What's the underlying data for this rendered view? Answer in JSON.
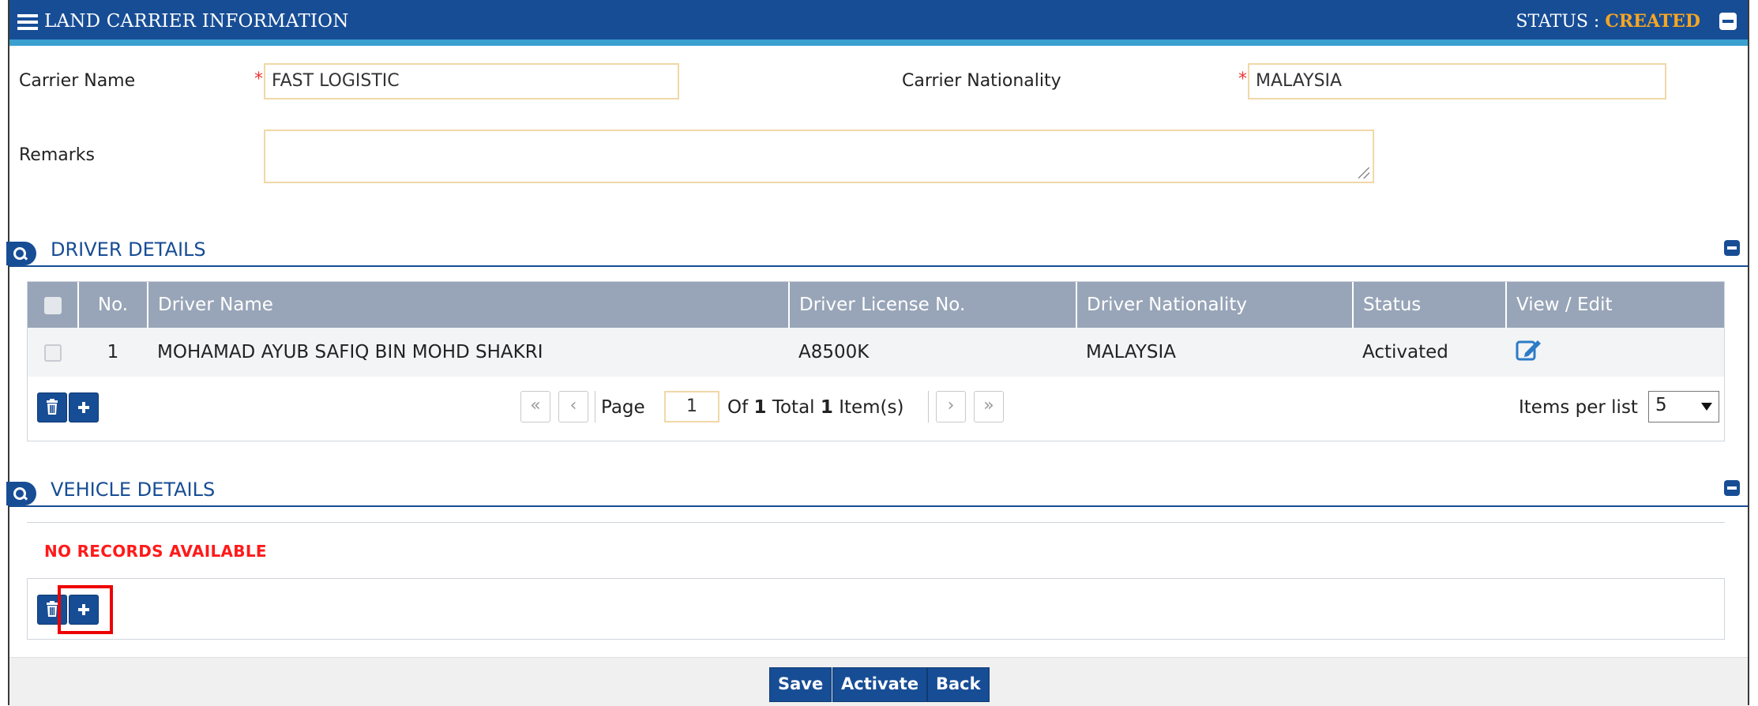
{
  "header": {
    "title": "LAND CARRIER INFORMATION",
    "status_label": "STATUS :",
    "status_value": "CREATED"
  },
  "form": {
    "carrier_name_label": "Carrier Name",
    "carrier_name_value": "FAST LOGISTIC",
    "carrier_nationality_label": "Carrier Nationality",
    "carrier_nationality_value": "MALAYSIA",
    "remarks_label": "Remarks",
    "remarks_value": "",
    "required_mark": "*"
  },
  "driver_section": {
    "title": "DRIVER DETAILS",
    "columns": [
      "No.",
      "Driver Name",
      "Driver License No.",
      "Driver Nationality",
      "Status",
      "View / Edit"
    ],
    "rows": [
      {
        "no": "1",
        "name": "MOHAMAD AYUB SAFIQ BIN MOHD SHAKRI",
        "license": "A8500K",
        "nationality": "MALAYSIA",
        "status": "Activated"
      }
    ],
    "pager": {
      "page_label": "Page",
      "page_value": "1",
      "of_label": "Of",
      "total_pages": "1",
      "total_label": "Total",
      "total_items": "1",
      "items_label": "Item(s)",
      "items_per_list_label": "Items per list",
      "items_per_list_value": "5",
      "first": "«",
      "prev": "‹",
      "next": "›",
      "last": "»"
    }
  },
  "vehicle_section": {
    "title": "VEHICLE DETAILS",
    "empty_message": "NO RECORDS AVAILABLE"
  },
  "footer": {
    "save": "Save",
    "activate": "Activate",
    "back": "Back"
  },
  "colors": {
    "primary": "#174d95",
    "status_value": "#f5a623",
    "empty_message": "#ff1a1a",
    "highlight": "#e00000"
  }
}
